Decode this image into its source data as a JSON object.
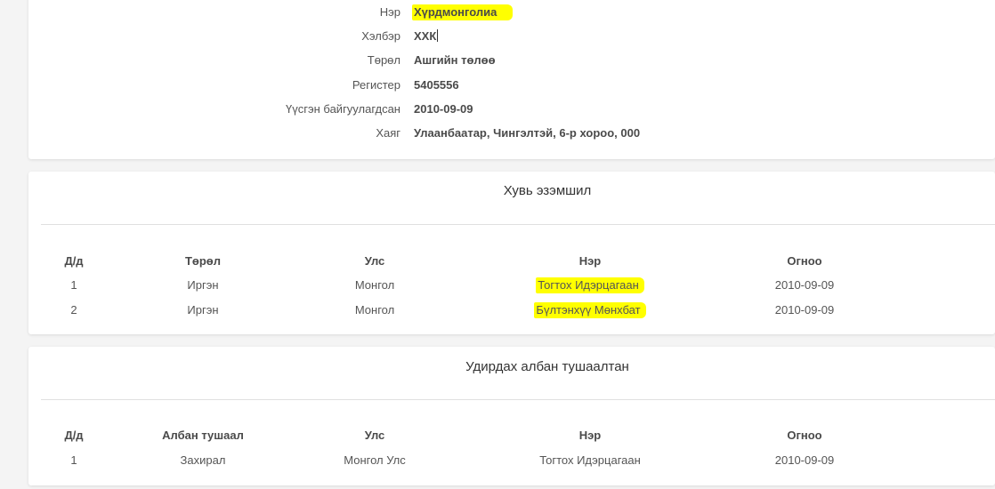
{
  "company_info": {
    "rows": [
      {
        "label": "Нэр",
        "value": "Хүрдмонголиа"
      },
      {
        "label": "Хэлбэр",
        "value": "ХХК"
      },
      {
        "label": "Төрөл",
        "value": "Ашгийн төлөө"
      },
      {
        "label": "Регистер",
        "value": "5405556"
      },
      {
        "label": "Үүсгэн байгуулагдсан",
        "value": "2010-09-09"
      },
      {
        "label": "Хаяг",
        "value": "Улаанбаатар, Чингэлтэй, 6-р хороо, 000"
      }
    ]
  },
  "ownership": {
    "title": "Хувь эзэмшил",
    "columns": [
      "Д/д",
      "Төрөл",
      "Улс",
      "Нэр",
      "Огноо"
    ],
    "rows": [
      [
        "1",
        "Иргэн",
        "Монгол",
        "Тогтох Идэрцагаан",
        "2010-09-09"
      ],
      [
        "2",
        "Иргэн",
        "Монгол",
        "Бүлтэнхүү Мөнхбат",
        "2010-09-09"
      ]
    ]
  },
  "officers": {
    "title": "Удирдах албан тушаалтан",
    "columns": [
      "Д/д",
      "Албан тушаал",
      "Улс",
      "Нэр",
      "Огноо"
    ],
    "rows": [
      [
        "1",
        "Захирал",
        "Монгол Улс",
        "Тогтох Идэрцагаан",
        "2010-09-09"
      ]
    ]
  },
  "colors": {
    "highlight": "#ffff00",
    "page_background": "#f4f4f4",
    "card_background": "#ffffff"
  }
}
